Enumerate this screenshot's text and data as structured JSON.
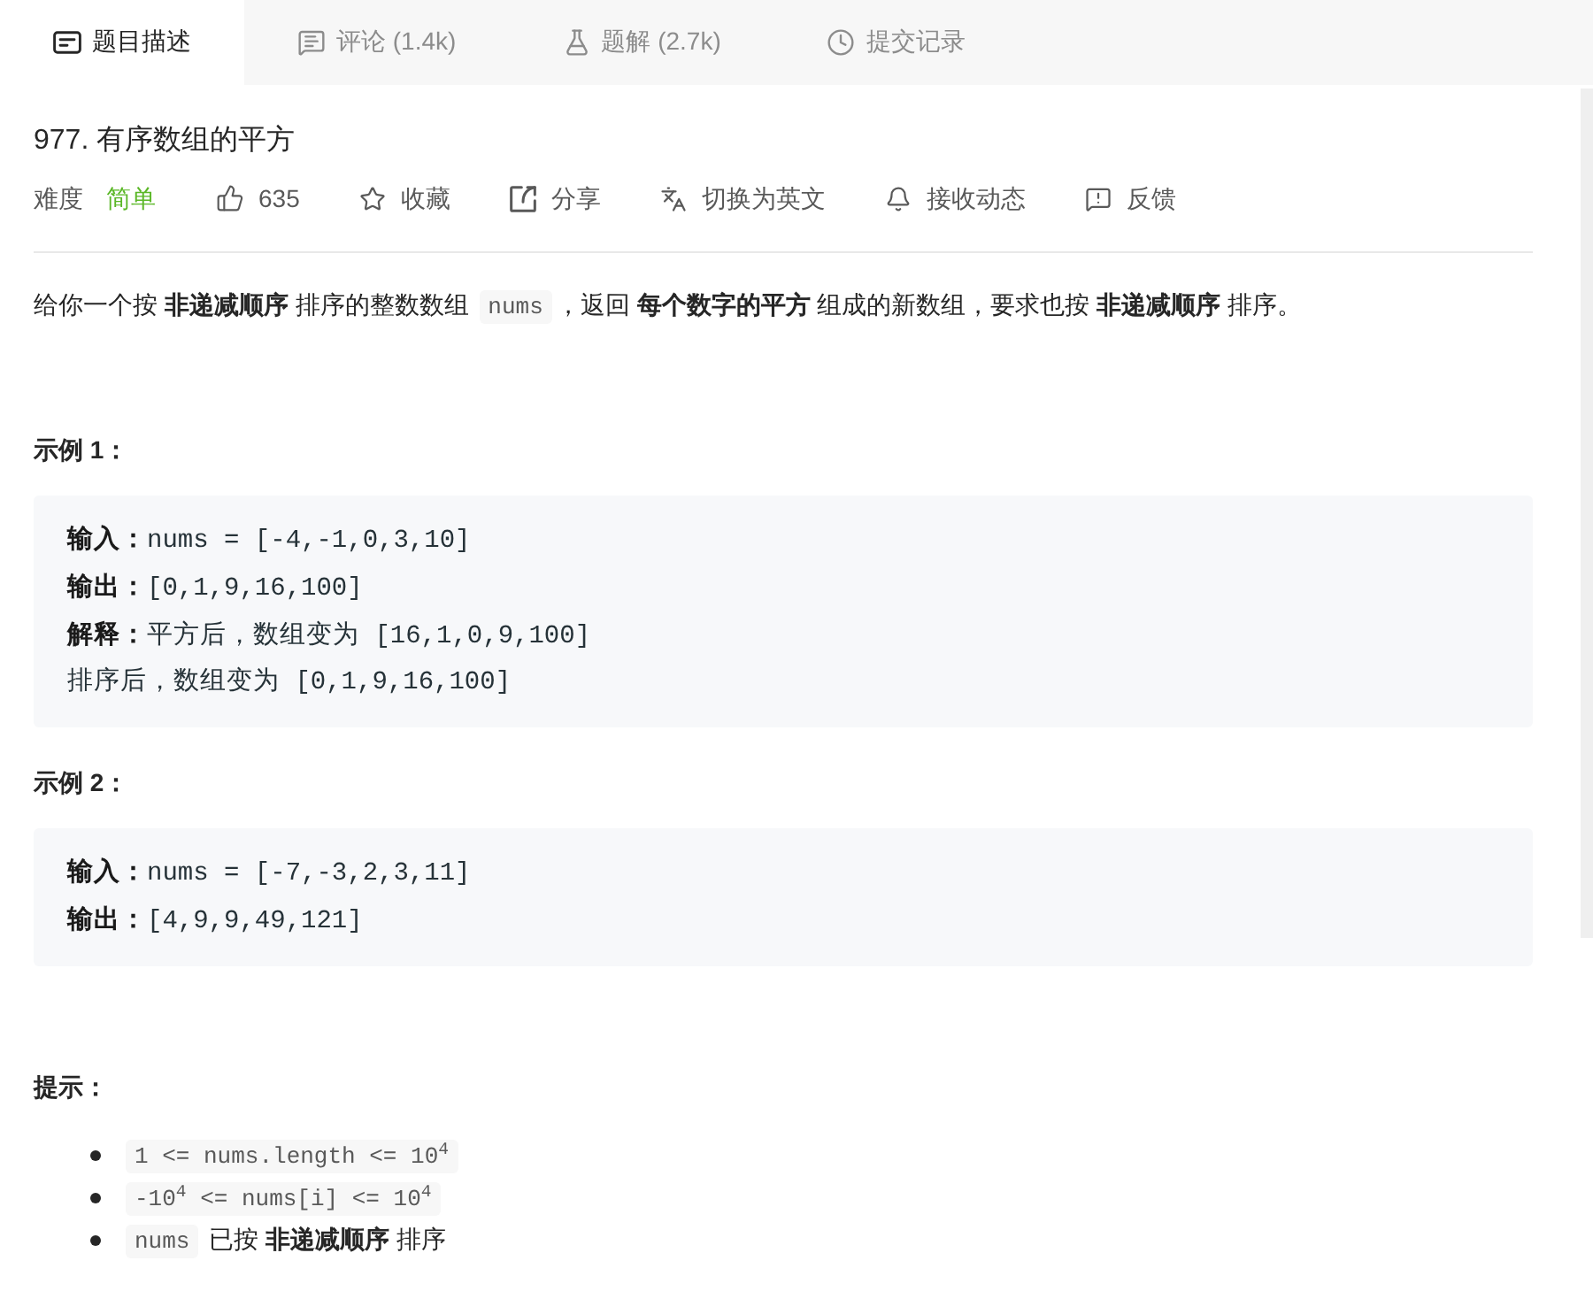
{
  "tabs": [
    {
      "label": "题目描述",
      "selected": true
    },
    {
      "label": "评论 (1.4k)",
      "selected": false
    },
    {
      "label": "题解 (2.7k)",
      "selected": false
    },
    {
      "label": "提交记录",
      "selected": false
    }
  ],
  "problem": {
    "title": "977. 有序数组的平方"
  },
  "meta": {
    "difficulty_label": "难度",
    "difficulty": "简单",
    "likes": "635",
    "actions": [
      {
        "label": "收藏"
      },
      {
        "label": "分享"
      },
      {
        "label": "切换为英文"
      },
      {
        "label": "接收动态"
      },
      {
        "label": "反馈"
      }
    ]
  },
  "description": [
    {
      "kind": "text",
      "text": "给你一个按 **非递减顺序** 排序的整数数组 "
    },
    {
      "kind": "code",
      "text": "nums"
    },
    {
      "kind": "text",
      "text": "，返回 **每个数字的平方** 组成的新数组，要求也按 **非递减顺序** 排序。"
    }
  ],
  "examples": [
    {
      "heading": "示例 1：",
      "lines": [
        "**输入：**nums = [-4,-1,0,3,10]",
        "**输出：**[0,1,9,16,100]",
        "**解释：**平方后，数组变为 [16,1,0,9,100]",
        "排序后，数组变为 [0,1,9,16,100]"
      ]
    },
    {
      "heading": "示例 2：",
      "lines": [
        "**输入：**nums = [-7,-3,2,3,11]",
        "**输出：**[4,9,9,49,121]"
      ]
    }
  ],
  "hints": {
    "heading": "提示：",
    "items": [
      [
        {
          "kind": "code",
          "text": "1 <= nums.length <= 10$^{4}$"
        }
      ],
      [
        {
          "kind": "code",
          "text": "-10$^{4}$ <= nums[i] <= 10$^{4}$"
        }
      ],
      [
        {
          "kind": "code",
          "text": "nums"
        },
        {
          "kind": "text",
          "text": " 已按 **非递减顺序** 排序"
        }
      ]
    ]
  }
}
